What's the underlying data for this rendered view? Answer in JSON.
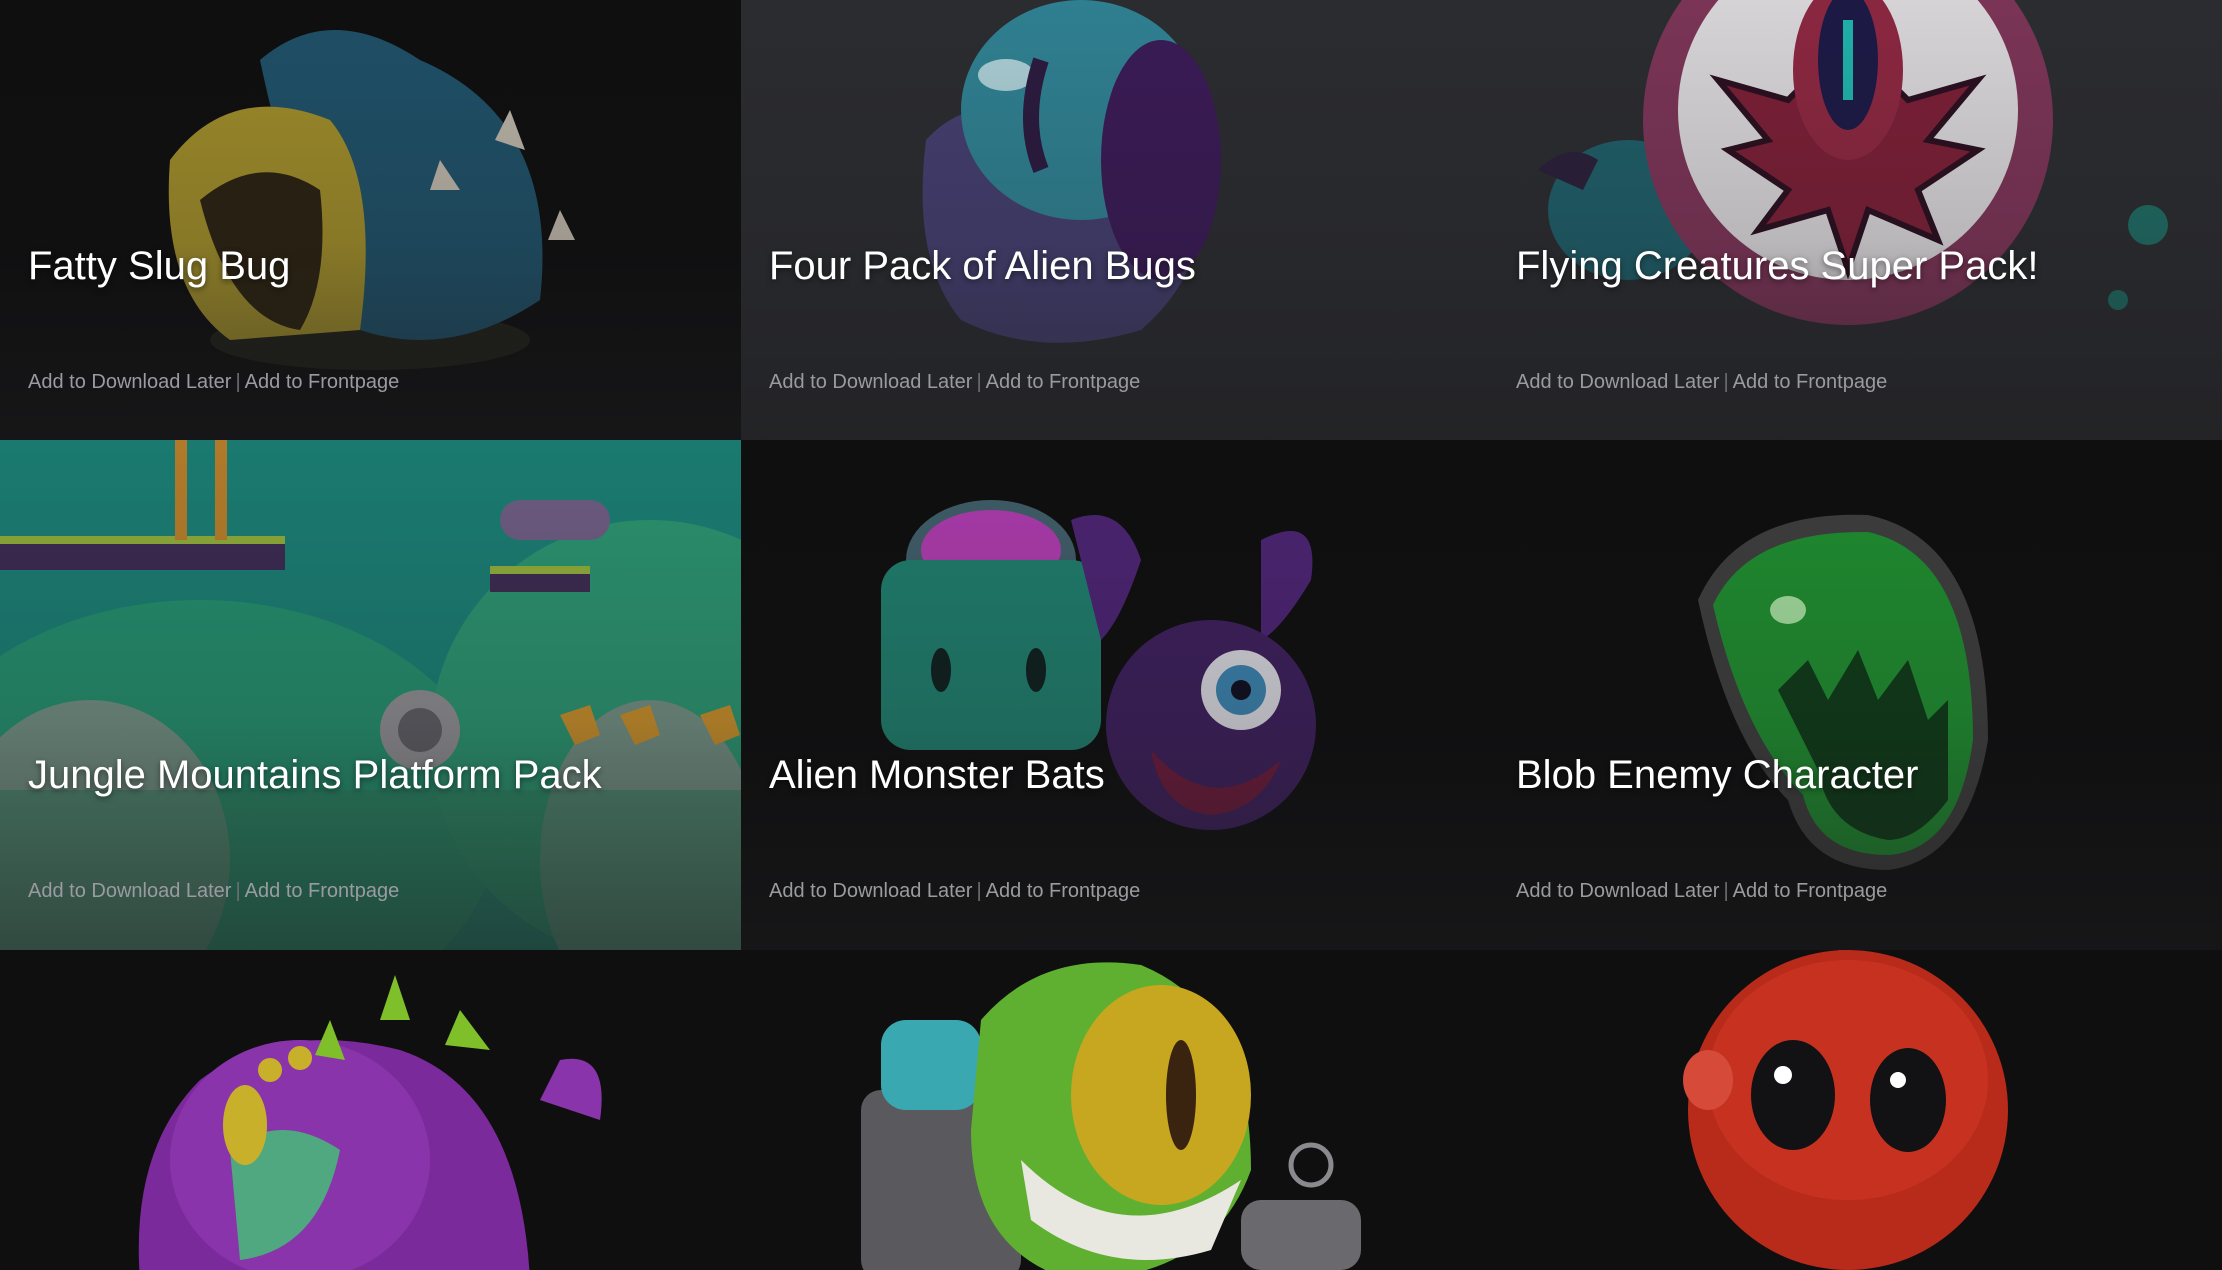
{
  "cards": [
    {
      "title": "Fatty Slug Bug",
      "download_later": "Add to Download Later",
      "separator": "|",
      "frontpage": "Add to Frontpage"
    },
    {
      "title": "Four Pack of Alien Bugs",
      "download_later": "Add to Download Later",
      "separator": "|",
      "frontpage": "Add to Frontpage"
    },
    {
      "title": "Flying Creatures Super Pack!",
      "download_later": "Add to Download Later",
      "separator": "|",
      "frontpage": "Add to Frontpage"
    },
    {
      "title": "Jungle Mountains Platform Pack",
      "download_later": "Add to Download Later",
      "separator": "|",
      "frontpage": "Add to Frontpage"
    },
    {
      "title": "Alien Monster Bats",
      "download_later": "Add to Download Later",
      "separator": "|",
      "frontpage": "Add to Frontpage"
    },
    {
      "title": "Blob Enemy Character",
      "download_later": "Add to Download Later",
      "separator": "|",
      "frontpage": "Add to Frontpage"
    },
    {
      "title": ""
    },
    {
      "title": ""
    },
    {
      "title": ""
    }
  ],
  "colors": {
    "background": "#111112",
    "title": "#ffffff",
    "action_link": "#9a9ba0"
  }
}
